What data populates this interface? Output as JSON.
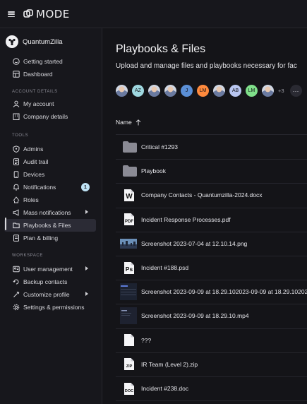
{
  "app": {
    "brand": "MODE"
  },
  "org": {
    "name": "QuantumZilla"
  },
  "sidebar": {
    "top_items": [
      {
        "label": "Getting started",
        "icon": "smile-icon"
      },
      {
        "label": "Dashboard",
        "icon": "dashboard-icon"
      }
    ],
    "section_account": "ACCOUNT DETAILS",
    "account_items": [
      {
        "label": "My account",
        "icon": "user-icon"
      },
      {
        "label": "Company details",
        "icon": "building-icon"
      }
    ],
    "section_tools": "TOOLS",
    "tools_items": [
      {
        "label": "Admins",
        "icon": "shield-icon"
      },
      {
        "label": "Audit trail",
        "icon": "audit-icon"
      },
      {
        "label": "Devices",
        "icon": "devices-icon"
      },
      {
        "label": "Notifications",
        "icon": "bell-icon",
        "badge": "1"
      },
      {
        "label": "Roles",
        "icon": "roles-icon"
      },
      {
        "label": "Mass notifications",
        "icon": "megaphone-icon"
      },
      {
        "label": "Playbooks & Files",
        "icon": "folder-icon",
        "active": true
      },
      {
        "label": "Plan & billing",
        "icon": "billing-icon"
      }
    ],
    "section_workspace": "WORKSPACE",
    "workspace_items": [
      {
        "label": "User management",
        "icon": "users-icon"
      },
      {
        "label": "Backup contacts",
        "icon": "backup-icon"
      },
      {
        "label": "Customize profile",
        "icon": "customize-icon"
      },
      {
        "label": "Settings & permissions",
        "icon": "gear-icon"
      }
    ]
  },
  "main": {
    "title": "Playbooks & Files",
    "subtitle": "Upload and manage files and playbooks necessary for fac",
    "avatars": [
      "",
      "AZ",
      "",
      "",
      "J",
      "LM",
      "",
      "AB",
      "LM",
      ""
    ],
    "avatar_colors": [
      "photo",
      "#9fd8e0",
      "photo",
      "photo",
      "#5b8fd6",
      "#ff8a3d",
      "photo",
      "#b9c6f0",
      "#7fe08a",
      "photo"
    ],
    "more_count": "+3",
    "table": {
      "name_header": "Name",
      "rows": [
        {
          "name": "Critical #1293",
          "type": "folder"
        },
        {
          "name": "Playbook",
          "type": "folder"
        },
        {
          "name": "Company Contacts - Quantumzilla-2024.docx",
          "type": "word"
        },
        {
          "name": "Incident Response Processes.pdf",
          "type": "pdf"
        },
        {
          "name": "Screenshot 2023-07-04 at 12.10.14.png",
          "type": "thumb-city"
        },
        {
          "name": "Incident #188.psd",
          "type": "ps"
        },
        {
          "name": "Screenshot 2023-09-09 at 18.29.102023-09-09 at 18.29.102023",
          "type": "thumb-ui"
        },
        {
          "name": "Screenshot 2023-09-09 at 18.29.10.mp4",
          "type": "thumb-dark"
        },
        {
          "name": "???",
          "type": "blank"
        },
        {
          "name": "IR Team (Level 2).zip",
          "type": "zip"
        },
        {
          "name": "Incident #238.doc",
          "type": "doc"
        }
      ]
    }
  }
}
